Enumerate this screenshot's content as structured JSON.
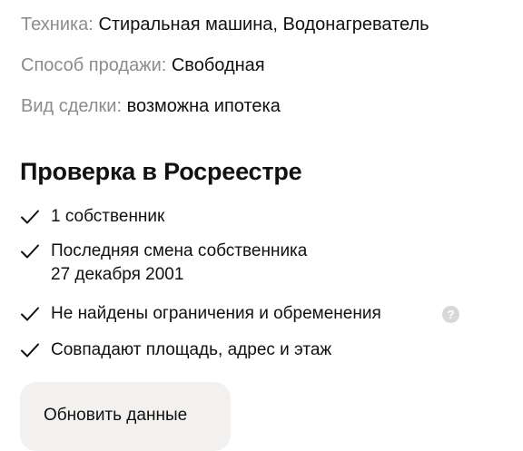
{
  "params": [
    {
      "label": "Техника:",
      "value": "Стиральная машина, Водонагреватель"
    },
    {
      "label": "Способ продажи:",
      "value": "Свободная"
    },
    {
      "label": "Вид сделки:",
      "value": "возможна ипотека"
    }
  ],
  "registry": {
    "title": "Проверка в Росреестре",
    "checks": [
      {
        "text": "1 собственник",
        "icon": "checkmark-icon"
      },
      {
        "text": "Последняя смена собственника",
        "text_line2": "27 декабря 2001",
        "icon": "checkmark-icon"
      },
      {
        "text": "Не найдены ограничения и обременения",
        "icon": "checkmark-icon",
        "help": "?"
      },
      {
        "text": "Совпадают площадь, адрес и этаж",
        "icon": "checkmark-icon"
      }
    ],
    "refresh_label": "Обновить данные"
  },
  "colors": {
    "label": "#8c8c8c",
    "text": "#111111",
    "button_bg": "#f2f1ef",
    "help_bg": "#d8d8d8"
  }
}
